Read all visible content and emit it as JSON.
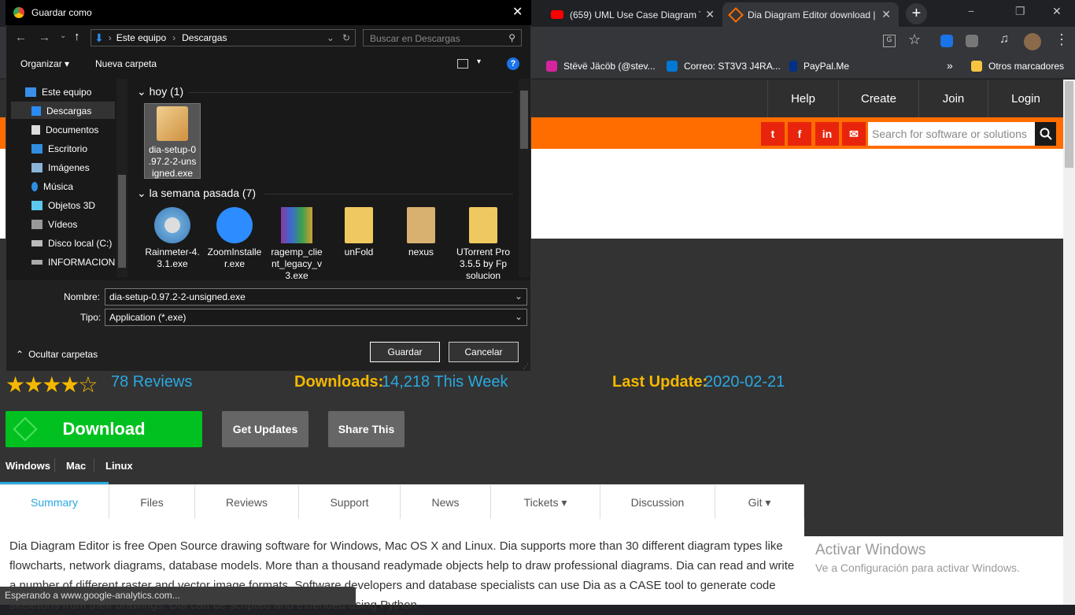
{
  "browser": {
    "tabs": [
      {
        "title": "(659) UML Use Case Diagram T"
      },
      {
        "title": "Dia Diagram Editor download |"
      }
    ],
    "new_tab": "+",
    "window_controls": [
      "−",
      "❐",
      "✕"
    ],
    "bookmarks": [
      {
        "label": "Stëvë Jäcöb (@stev..."
      },
      {
        "label": "Correo: ST3V3 J4RA..."
      },
      {
        "label": "PayPal.Me"
      }
    ],
    "bookmarks_more": "»",
    "other_bookmarks": "Otros marcadores"
  },
  "site": {
    "nav": [
      "Help",
      "Create",
      "Join",
      "Login"
    ],
    "search_placeholder": "Search for software or solutions",
    "rating_count": "78 Reviews",
    "downloads_label": "Downloads:",
    "downloads_value": "14,218 This Week",
    "last_update_label": "Last Update:",
    "last_update_value": "2020-02-21",
    "download_button": "Download",
    "get_updates": "Get Updates",
    "share_this": "Share This",
    "os": [
      "Windows",
      "Mac",
      "Linux"
    ],
    "tabs": [
      "Summary",
      "Files",
      "Reviews",
      "Support",
      "News",
      "Tickets ▾",
      "Discussion",
      "Git ▾"
    ],
    "description": "Dia Diagram Editor is free Open Source drawing software for Windows, Mac OS X and Linux. Dia supports more than 30 different diagram types like flowcharts, network diagrams, database models. More than a thousand readymade objects help to draw professional diagrams. Dia can read and write a number of different raster and vector image formats. Software developers and database specialists can use Dia as a CASE tool to generate code skeletons from their drawings. Dia can be scripted and extended using Python.",
    "activate_title": "Activar Windows",
    "activate_sub": "Ve a Configuración para activar Windows.",
    "status": "Esperando a www.google-analytics.com..."
  },
  "dialog": {
    "title": "Guardar como",
    "path": [
      "Este equipo",
      "Descargas"
    ],
    "search_placeholder": "Buscar en Descargas",
    "organize": "Organizar ▾",
    "new_folder": "Nueva carpeta",
    "nav_items": [
      "Este equipo",
      "Descargas",
      "Documentos",
      "Escritorio",
      "Imágenes",
      "Música",
      "Objetos 3D",
      "Vídeos",
      "Disco local (C:)",
      "INFORMACION"
    ],
    "group_today": "hoy (1)",
    "group_week": "la semana pasada (7)",
    "today_files": [
      "dia-setup-0.97.2-2-unsigned.exe"
    ],
    "today_file_display": "dia-setup-0\n.97.2-2-uns\nigned.exe",
    "week_files": [
      {
        "name": "Rainmeter-4.3.1.exe"
      },
      {
        "name": "ZoomInstaller.exe"
      },
      {
        "name": "ragemp_client_legacy_v3.exe"
      },
      {
        "name": "unFold"
      },
      {
        "name": "nexus"
      },
      {
        "name": "UTorrent Pro 3.5.5 by Fp solucion"
      }
    ],
    "name_label": "Nombre:",
    "name_value": "dia-setup-0.97.2-2-unsigned.exe",
    "type_label": "Tipo:",
    "type_value": "Application (*.exe)",
    "hide_folders": "Ocultar carpetas",
    "save": "Guardar",
    "cancel": "Cancelar"
  }
}
